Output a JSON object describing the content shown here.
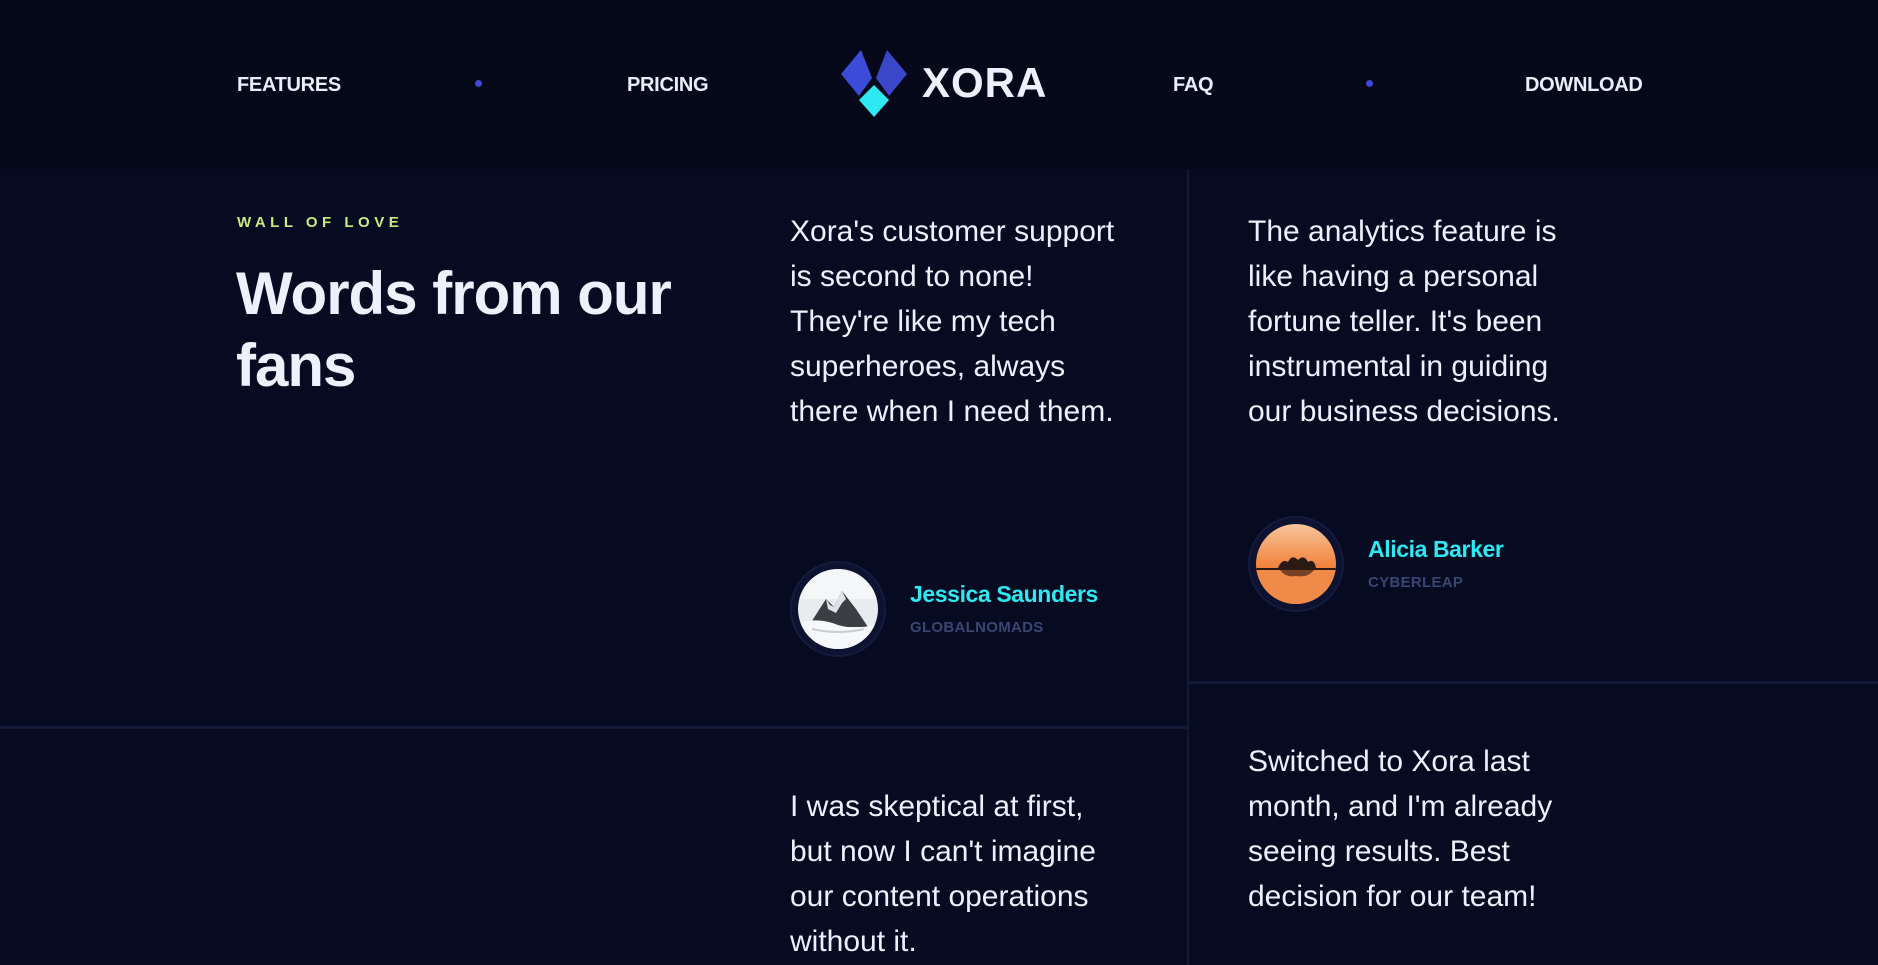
{
  "nav": {
    "links": [
      "FEATURES",
      "PRICING",
      "FAQ",
      "DOWNLOAD"
    ],
    "logo_text": "XORA",
    "colors": {
      "dot": "#3d4bd9",
      "logo_primary": "#3d4bd9",
      "logo_accent": "#2ee8f2"
    }
  },
  "section": {
    "eyebrow": "WALL OF LOVE",
    "heading": "Words from our fans"
  },
  "testimonials": [
    {
      "quote": "Xora's customer support is second to none! They're like my tech superheroes, always there when I need them.",
      "name": "Jessica Saunders",
      "company": "GLOBALNOMADS",
      "avatar_icon": "snowy-mountain-avatar"
    },
    {
      "quote": "The analytics feature is like having a personal fortune teller. It's been instrumental in guiding our business decisions.",
      "name": "Alicia Barker",
      "company": "CYBERLEAP",
      "avatar_icon": "sunset-island-avatar"
    },
    {
      "quote": "I was skeptical at first, but now I can't imagine our content operations without it."
    },
    {
      "quote": "Switched to Xora last month, and I'm already seeing results. Best decision for our team!"
    }
  ],
  "colors": {
    "background": "#070b22",
    "header_background": "#050818",
    "eyebrow": "#c8ea80",
    "author_name": "#2ee8f2",
    "author_company": "#3a4572",
    "divider": "#121837"
  }
}
